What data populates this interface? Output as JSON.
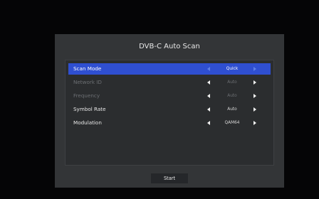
{
  "dialog": {
    "title": "DVB-C Auto Scan",
    "rows": [
      {
        "label": "Scan Mode",
        "value": "Quick",
        "state": "selected"
      },
      {
        "label": "Network ID",
        "value": "Auto",
        "state": "disabled"
      },
      {
        "label": "Frequency",
        "value": "Auto",
        "state": "disabled"
      },
      {
        "label": "Symbol Rate",
        "value": "Auto",
        "state": "normal"
      },
      {
        "label": "Modulation",
        "value": "QAM64",
        "state": "normal"
      }
    ],
    "start_label": "Start"
  },
  "colors": {
    "background": "#050506",
    "dialog": "#333537",
    "panel": "#2b2d2f",
    "selected_row": "#2f4fd1",
    "disabled_text": "#6c6f73"
  },
  "icons": {
    "decrease": "chevron-left-icon",
    "increase": "chevron-right-icon"
  }
}
